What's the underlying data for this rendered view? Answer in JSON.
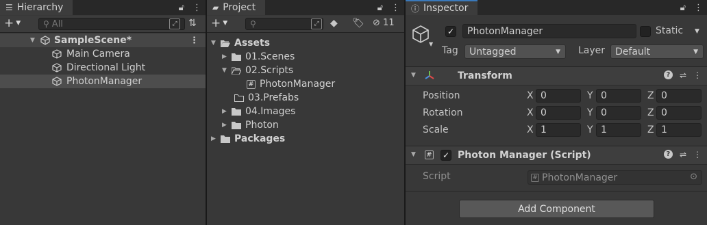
{
  "hierarchy": {
    "tab": "Hierarchy",
    "search_placeholder": "All",
    "scene": "SampleScene*",
    "items": [
      "Main Camera",
      "Directional Light",
      "PhotonManager"
    ]
  },
  "project": {
    "tab": "Project",
    "hidden_count": "11",
    "tree": [
      {
        "label": "Assets",
        "bold": true
      },
      {
        "label": "01.Scenes"
      },
      {
        "label": "02.Scripts"
      },
      {
        "label": "PhotonManager"
      },
      {
        "label": "03.Prefabs"
      },
      {
        "label": "04.Images"
      },
      {
        "label": "Photon"
      },
      {
        "label": "Packages",
        "bold": true
      }
    ]
  },
  "inspector": {
    "tab": "Inspector",
    "object_name": "PhotonManager",
    "static_label": "Static",
    "tag_label": "Tag",
    "tag_value": "Untagged",
    "layer_label": "Layer",
    "layer_value": "Default",
    "transform": {
      "title": "Transform",
      "rows": [
        {
          "label": "Position",
          "x": "0",
          "y": "0",
          "z": "0"
        },
        {
          "label": "Rotation",
          "x": "0",
          "y": "0",
          "z": "0"
        },
        {
          "label": "Scale",
          "x": "1",
          "y": "1",
          "z": "1"
        }
      ],
      "axis_x": "X",
      "axis_y": "Y",
      "axis_z": "Z"
    },
    "script_component": {
      "title": "Photon Manager (Script)",
      "script_label": "Script",
      "script_value": "PhotonManager"
    },
    "add_component": "Add Component"
  }
}
